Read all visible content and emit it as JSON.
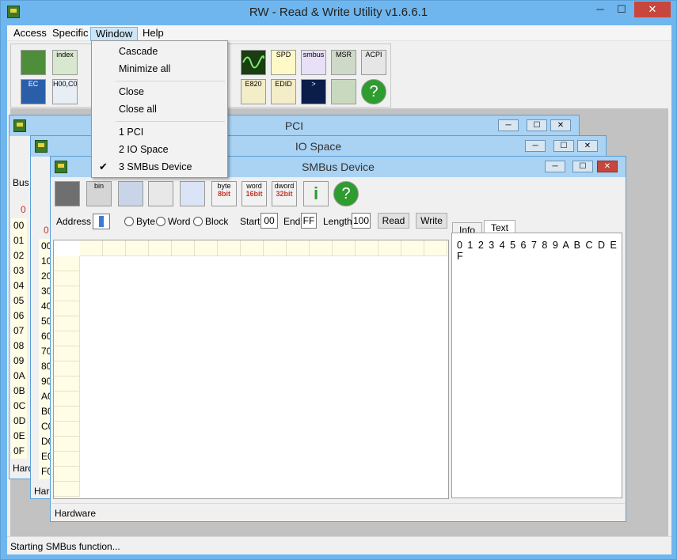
{
  "app": {
    "title": "RW - Read & Write Utility v1.6.6.1"
  },
  "window_controls": {
    "minimize": "─",
    "maximize": "☐",
    "close": "✕"
  },
  "menu": {
    "items": [
      "Access",
      "Specific",
      "Window",
      "Help"
    ],
    "open": "Window"
  },
  "window_menu": {
    "items": [
      {
        "label": "Cascade"
      },
      {
        "label": "Minimize all"
      },
      {
        "label": "Close"
      },
      {
        "label": "Close all"
      },
      {
        "label": "1 PCI"
      },
      {
        "label": "2 IO Space"
      },
      {
        "label": "3 SMBus Device",
        "checked": true
      }
    ],
    "checkmark": "✔"
  },
  "toolbar": {
    "row1": [
      "pci-icon",
      "index-icon",
      "",
      "",
      "",
      "",
      "waveform-icon",
      "spd-icon",
      "smbus-icon",
      "msr-icon",
      "acpi-icon"
    ],
    "row2": [
      "ec-icon",
      "h00-cd-icon",
      "",
      "",
      "",
      "",
      "e820-icon",
      "edid-icon",
      "command-icon",
      "device-icon",
      "help-icon"
    ],
    "labels": {
      "index": "index",
      "spd": "SPD",
      "smbus": "smbus",
      "msr": "MSR",
      "acpi": "ACPI",
      "ec": "EC",
      "h00": "H00,C0",
      "e820": "E820",
      "edid": "EDID",
      "cmd": ">"
    }
  },
  "windows": {
    "pci": {
      "title": "PCI",
      "row_labels": [
        "00",
        "01",
        "02",
        "03",
        "04",
        "05",
        "06",
        "07",
        "08",
        "09",
        "0A",
        "0B",
        "0C",
        "0D",
        "0E",
        "0F"
      ],
      "bus_label": "Bus",
      "header_col": "0",
      "status": "Hard"
    },
    "io": {
      "title": "IO Space",
      "row_labels": [
        "00",
        "10",
        "20",
        "30",
        "40",
        "50",
        "60",
        "70",
        "80",
        "90",
        "A0",
        "B0",
        "C0",
        "D0",
        "E0",
        "F0"
      ],
      "header_col": "0",
      "status": "Hard"
    },
    "smbus": {
      "title": "SMBus Device",
      "toolbar": {
        "byte": "byte",
        "byte_bits": "8bit",
        "word": "word",
        "word_bits": "16bit",
        "dword": "dword",
        "dword_bits": "32bit",
        "bin": "bin",
        "info": "i",
        "help": "?"
      },
      "address_label": "Address",
      "radio": {
        "byte": "Byte",
        "word": "Word",
        "block": "Block"
      },
      "start_label": "Start",
      "start_value": "00",
      "end_label": "End",
      "end_value": "FF",
      "length_label": "Length",
      "length_value": "100",
      "read": "Read",
      "write": "Write",
      "tabs": [
        "Info",
        "Text"
      ],
      "active_tab": "Text",
      "hex_header": "0 1 2 3 4 5 6 7 8 9 A B C D E F",
      "status": "Hardware"
    }
  },
  "status": {
    "text": "Starting SMBus function..."
  }
}
